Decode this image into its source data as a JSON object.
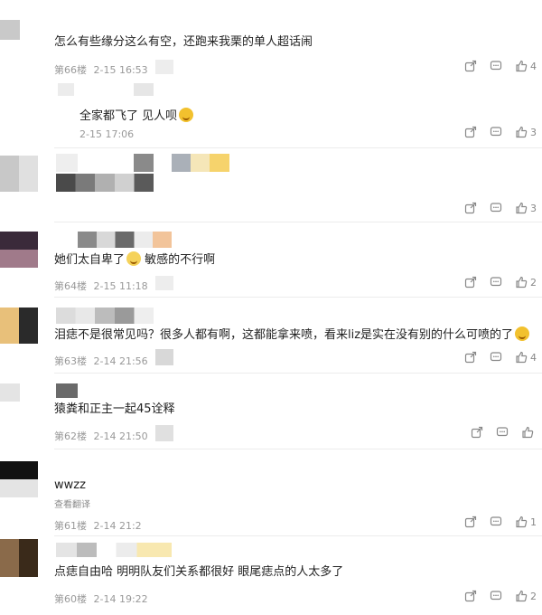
{
  "comments": [
    {
      "text": "怎么有些缘分这么有空，还跑来我栗的单人超话闹",
      "floor": "第66楼",
      "time": "2-15 16:53",
      "likes": "4"
    },
    {
      "text": "她们太自卑了",
      "text2": "敏感的不行啊",
      "floor": "第64楼",
      "time": "2-15 11:18",
      "likes": "2"
    },
    {
      "text": "泪痣不是很常见吗？很多人都有啊，这都能拿来喷，看来liz是实在没有别的什么可喷的了",
      "floor": "第63楼",
      "time": "2-14 21:56",
      "likes": "4"
    },
    {
      "text": "猿粪和正主一起45诠释",
      "floor": "第62楼",
      "time": "2-14 21:50",
      "likes": ""
    },
    {
      "text": "wwzz",
      "translate": "查看翻译",
      "floor": "第61楼",
      "time": "2-14 21:2",
      "likes": "1"
    },
    {
      "text": "点痣自由哈 明明队友们关系都很好 眼尾痣点的人太多了",
      "floor": "第60楼",
      "time": "2-14 19:22",
      "likes": "2"
    }
  ],
  "replies": [
    {
      "text": "全家都飞了 见人呗",
      "time": "2-15 17:06",
      "likes": "3"
    }
  ],
  "block3": {
    "likes": "3"
  },
  "icons": [
    "share-icon",
    "comment-icon",
    "like-icon"
  ]
}
